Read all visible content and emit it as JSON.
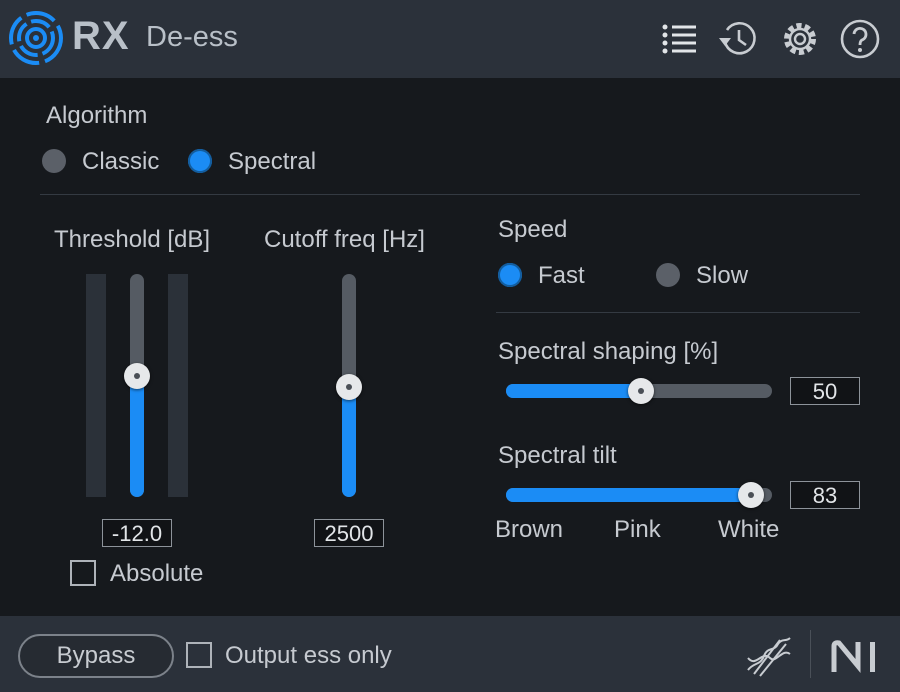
{
  "header": {
    "brand": "RX",
    "plugin_name": "De-ess",
    "icons": [
      "presets-list-icon",
      "history-icon",
      "settings-gear-icon",
      "help-icon"
    ]
  },
  "algorithm": {
    "title": "Algorithm",
    "options": [
      {
        "label": "Classic",
        "selected": false
      },
      {
        "label": "Spectral",
        "selected": true
      }
    ]
  },
  "threshold": {
    "label": "Threshold [dB]",
    "value": "-12.0",
    "level_fraction": 0.47,
    "absolute_label": "Absolute",
    "absolute_checked": false
  },
  "cutoff": {
    "label": "Cutoff freq [Hz]",
    "value": "2500",
    "level_fraction": 0.5
  },
  "speed": {
    "title": "Speed",
    "options": [
      {
        "label": "Fast",
        "selected": true
      },
      {
        "label": "Slow",
        "selected": false
      }
    ]
  },
  "spectral_shaping": {
    "label": "Spectral shaping [%]",
    "value": "50",
    "percent": 50
  },
  "spectral_tilt": {
    "label": "Spectral tilt",
    "value": "83",
    "ticks": [
      "Brown",
      "Pink",
      "White"
    ]
  },
  "footer": {
    "bypass_label": "Bypass",
    "output_ess_label": "Output ess only",
    "output_ess_checked": false
  },
  "colors": {
    "accent": "#1b8cf5",
    "background": "#16191d",
    "panel": "#2b313a"
  }
}
